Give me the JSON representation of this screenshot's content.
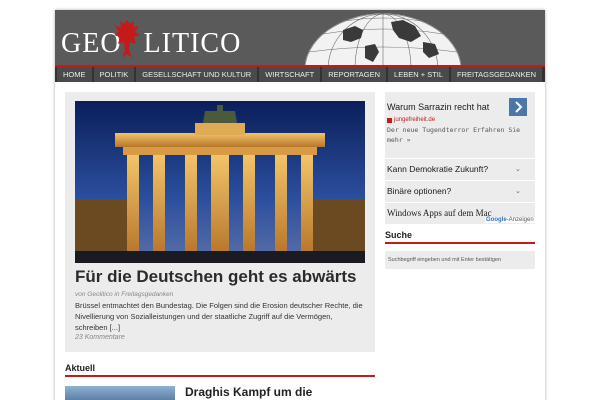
{
  "header": {
    "logo_left": "GEO",
    "logo_right": "LITICO"
  },
  "nav": {
    "items": [
      "Home",
      "Politik",
      "Gesellschaft und Kultur",
      "Wirtschaft",
      "Reportagen",
      "Leben + Stil",
      "Freitagsgedanken"
    ]
  },
  "featured": {
    "title": "Für die Deutschen geht es abwärts",
    "meta": "von Geolitico in Freitagsgedanken",
    "excerpt": "Brüssel entmachtet den Bundestag. Die Folgen sind die Erosion deutscher Rechte, die Nivellierung von Sozialleistungen und der staatliche Zugriff auf die Vermögen, schreiben [...]",
    "comments": "23 Kommentare"
  },
  "section": {
    "aktuell": "Aktuell",
    "post_title": "Draghis Kampf um die"
  },
  "ads": {
    "ad1_title": "Warum Sarrazin recht hat",
    "ad1_source": "jungefreiheit.de",
    "ad1_text": "Der neue Tugendterror Erfahren Sie mehr »",
    "links": [
      "Kann Demokratie Zukunft?",
      "Binäre optionen?",
      "Windows Apps auf dem Mac"
    ],
    "label_google": "Google",
    "label_suffix": "-Anzeigen"
  },
  "search": {
    "heading": "Suche",
    "placeholder": "Suchbegriff eingeben und mit Enter bestätigen"
  },
  "colors": {
    "accent": "#c41a1a",
    "header_bg": "#5a5a5a",
    "nav_bg": "#333333",
    "box_bg": "#ececec",
    "ad_button": "#4a76a8"
  }
}
